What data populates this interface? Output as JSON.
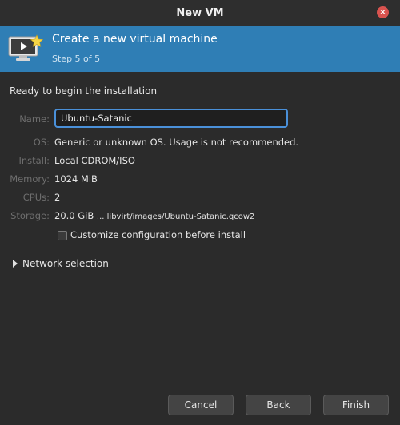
{
  "window": {
    "title": "New VM",
    "close_glyph": "×"
  },
  "header": {
    "title": "Create a new virtual machine",
    "step": "Step 5 of 5",
    "icon": "vm-monitor-star-icon",
    "accent_color": "#2f7eb5"
  },
  "summary": {
    "intro": "Ready to begin the installation",
    "name_label": "Name:",
    "name_value": "Ubuntu-Satanic",
    "os_label": "OS:",
    "os_value": "Generic or unknown OS. Usage is not recommended.",
    "install_label": "Install:",
    "install_value": "Local CDROM/ISO",
    "memory_label": "Memory:",
    "memory_value": "1024 MiB",
    "cpus_label": "CPUs:",
    "cpus_value": "2",
    "storage_label": "Storage:",
    "storage_size": "20.0 GiB",
    "storage_path": "... libvirt/images/Ubuntu-Satanic.qcow2"
  },
  "customize": {
    "label": "Customize configuration before install",
    "checked": false
  },
  "network": {
    "label": "Network selection",
    "expanded": false
  },
  "buttons": {
    "cancel": "Cancel",
    "back": "Back",
    "finish": "Finish"
  }
}
